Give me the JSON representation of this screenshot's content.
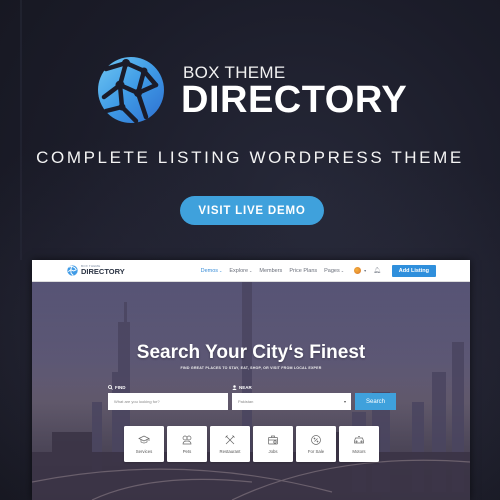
{
  "banner": {
    "brand_small": "BOX THEME",
    "brand_big": "DIRECTORY",
    "tagline": "COMPLETE LISTING WORDPRESS THEME",
    "cta_label": "VISIT LIVE DEMO",
    "logo_icon": "globe-network-icon",
    "colors": {
      "accent": "#3fa1dc",
      "background": "#1b1c29"
    }
  },
  "mockup": {
    "navbar": {
      "logo_small": "BOX THEME",
      "logo_big": "DIRECTORY",
      "links": [
        {
          "label": "Demos",
          "has_caret": true,
          "active": true
        },
        {
          "label": "Explore",
          "has_caret": true,
          "active": false
        },
        {
          "label": "Members",
          "has_caret": false,
          "active": false
        },
        {
          "label": "Price Plans",
          "has_caret": false,
          "active": false
        },
        {
          "label": "Pages",
          "has_caret": true,
          "active": false
        }
      ],
      "caret_glyph": "⌄",
      "avatar_caret": "▾",
      "bell_glyph": "🔔︎",
      "add_listing_label": "Add Listing"
    },
    "hero": {
      "title": "Search Your City‘s Finest",
      "subtitle": "FIND GREAT PLACES TO STAY, EAT, SHOP, OR VISIT FROM LOCAL EXPER"
    },
    "search": {
      "find_label": "FIND",
      "near_label": "NEAR",
      "find_placeholder": "What are you looking for?",
      "near_value": "Pakistan",
      "near_caret": "▾",
      "button_label": "Search"
    },
    "categories": [
      {
        "label": "Services",
        "icon": "graduation-cap-icon"
      },
      {
        "label": "Pets",
        "icon": "pets-icon"
      },
      {
        "label": "Restaurant",
        "icon": "fork-knife-icon"
      },
      {
        "label": "Jobs",
        "icon": "briefcase-icon"
      },
      {
        "label": "For Sale",
        "icon": "percent-tag-icon"
      },
      {
        "label": "Motors",
        "icon": "car-icon"
      }
    ]
  }
}
